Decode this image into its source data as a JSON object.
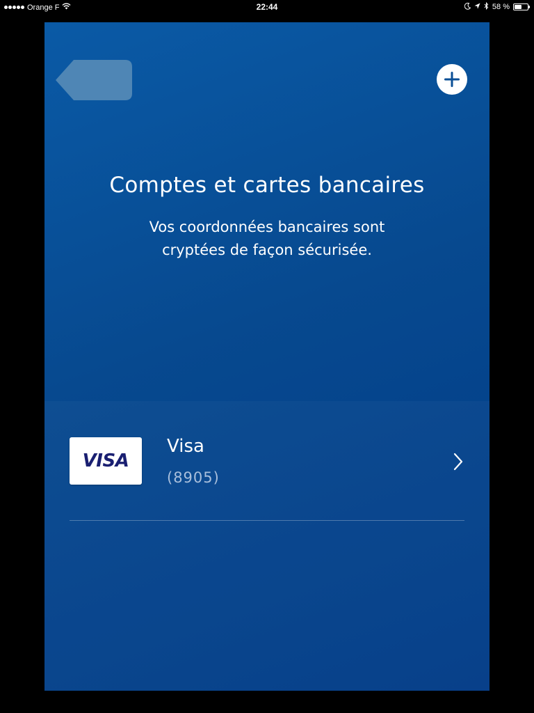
{
  "status_bar": {
    "carrier": "Orange F",
    "time": "22:44",
    "battery_percent": "58 %",
    "battery_level": 0.58,
    "icons": [
      "signal-dots-icon",
      "wifi-icon",
      "moon-icon",
      "location-arrow-icon",
      "bluetooth-icon",
      "battery-icon"
    ]
  },
  "header": {
    "back_icon": "back-arrow-icon",
    "add_icon": "plus-icon",
    "title": "Comptes et cartes bancaires",
    "subtitle": "Vos coordonnées bancaires sont cryptées de façon sécurisée."
  },
  "cards": [
    {
      "logo_text": "VISA",
      "name": "Visa",
      "number": "(8905)",
      "icon": "chevron-right-icon"
    }
  ],
  "colors": {
    "background_top": "#0a5aa6",
    "background_bottom": "#003a87",
    "accent": "#0b4f96",
    "visa_blue": "#1a1f71",
    "muted_text": "#a9bfdc"
  }
}
